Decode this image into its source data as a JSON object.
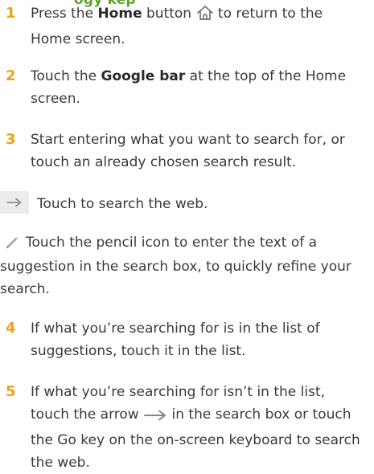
{
  "heading_fragment": "ogy kep",
  "steps": [
    {
      "num": "1",
      "pre": "Press the ",
      "bold": "Home",
      "mid": " button ",
      "icon": "home-icon",
      "post": " to return to the Home screen."
    },
    {
      "num": "2",
      "pre": "Touch the ",
      "bold": "Google bar",
      "post": " at the top of the Home screen."
    },
    {
      "num": "3",
      "text": "Start entering what you want to search for, or touch an already chosen search result."
    },
    {
      "num": "4",
      "text": "If what you’re searching for is in the list of suggestions, touch it in the list."
    },
    {
      "num": "5",
      "pre": "If what you’re searching for isn’t in the list, touch the arrow ",
      "icon": "arrow-right-icon",
      "post": " in the search box or touch the Go key on the on-screen keyboard to search the web."
    }
  ],
  "notes": {
    "search_web": {
      "icon": "arrow-right-icon",
      "text": "Touch to search the web."
    },
    "pencil": {
      "icon": "pencil-icon",
      "text": "Touch the pencil icon to enter the text of a suggestion in the search box, to quickly refine your search."
    }
  },
  "colors": {
    "step_number": "#f0a017",
    "heading": "#5ba52a",
    "body_text": "#3a3a3a",
    "icon_box": "#ececec"
  }
}
